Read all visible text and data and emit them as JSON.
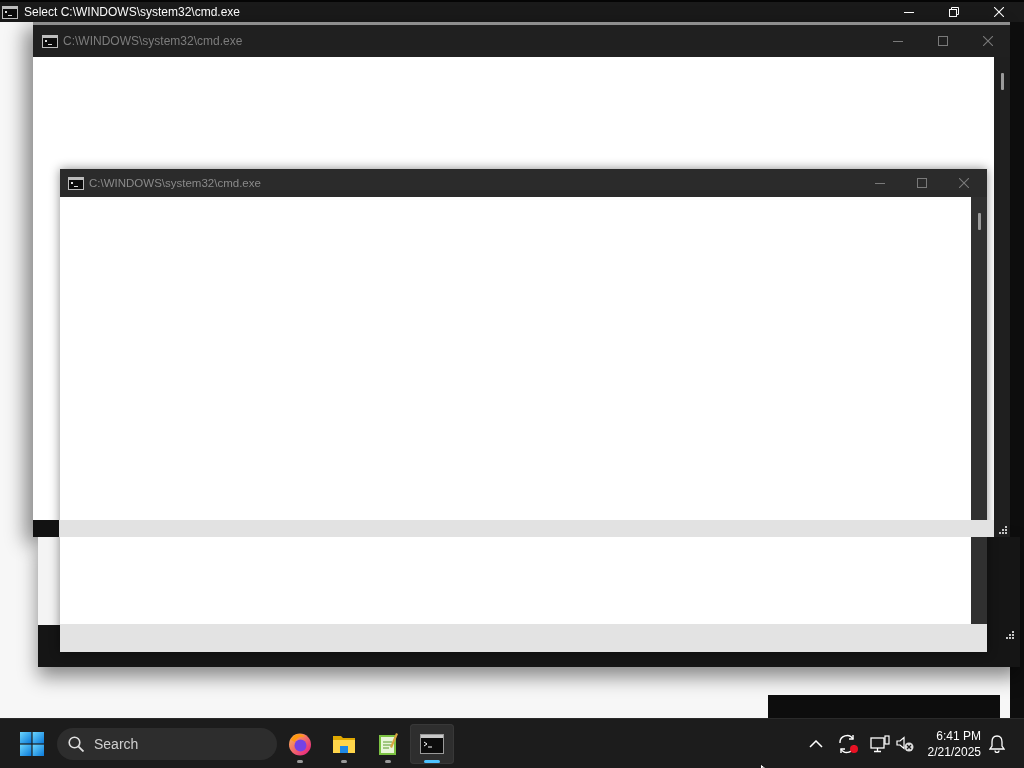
{
  "windows": [
    {
      "title": "Select C:\\WINDOWS\\system32\\cmd.exe",
      "active": true,
      "maximized": true
    },
    {
      "title": "C:\\WINDOWS\\system32\\cmd.exe",
      "active": false,
      "maximized": false
    },
    {
      "title": "C:\\WINDOWS\\system32\\cmd.exe",
      "active": false,
      "maximized": false
    }
  ],
  "taskbar": {
    "search": {
      "placeholder": "Search"
    },
    "apps": [
      {
        "selected": false
      },
      {
        "selected": false
      },
      {
        "selected": false
      },
      {
        "selected": true
      }
    ],
    "clock": {
      "time": "6:41 PM",
      "date": "2/21/2025"
    }
  }
}
